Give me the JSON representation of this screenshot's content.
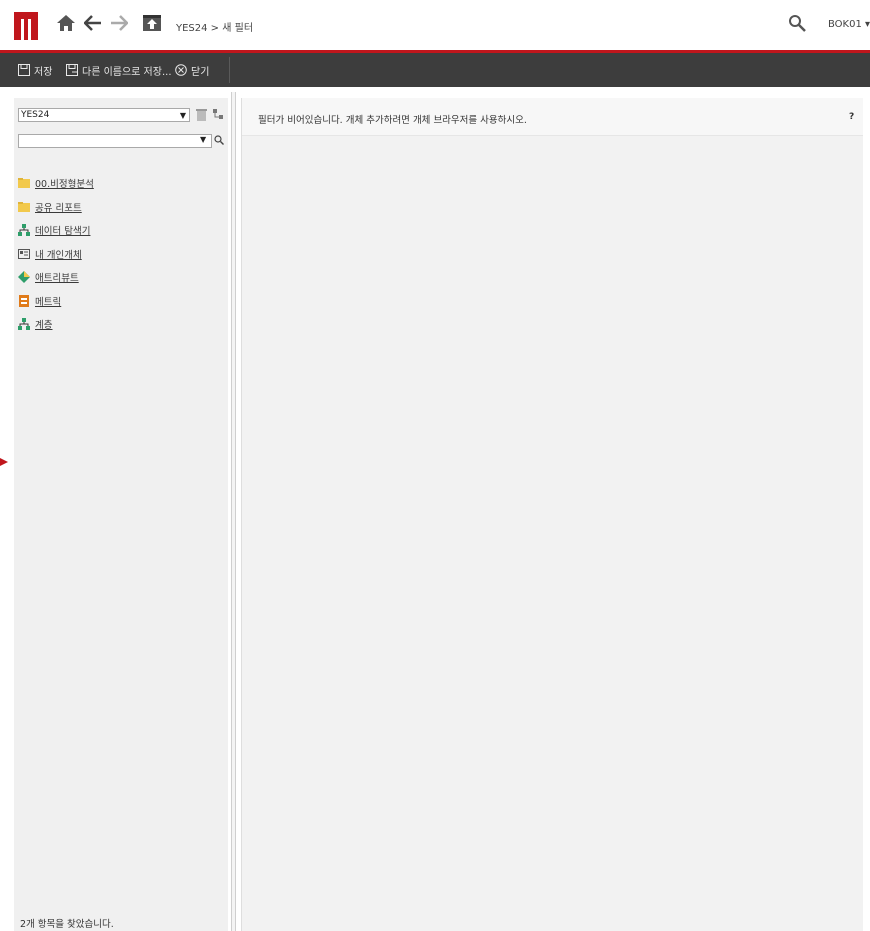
{
  "header": {
    "breadcrumb": "YES24 > 새 필터",
    "user": "BOK01 ▾",
    "accent_color": "#c0161c",
    "icons": [
      "microstrategy-logo",
      "home-icon",
      "back-arrow-icon",
      "forward-arrow-icon",
      "up-folder-icon",
      "search-icon"
    ]
  },
  "toolbar": {
    "save_label": "저장",
    "save_as_label": "다른 이름으로 저장...",
    "close_label": "닫기"
  },
  "left_panel": {
    "project_select": "YES24",
    "search_value": "",
    "tree": [
      {
        "label": "00.비정형분석",
        "icon": "folder-icon",
        "color": "#f2c94c"
      },
      {
        "label": "공유 리포트",
        "icon": "folder-icon",
        "color": "#f2c94c"
      },
      {
        "label": "데이터 탐색기",
        "icon": "hierarchy-icon",
        "color": "#2e9e6a"
      },
      {
        "label": "내 개인개체",
        "icon": "personal-objects-icon",
        "color": "#555555"
      },
      {
        "label": "애트리뷰트",
        "icon": "attribute-icon",
        "color": "#2e9e6a"
      },
      {
        "label": "메트릭",
        "icon": "metric-icon",
        "color": "#e07b1a"
      },
      {
        "label": "계층",
        "icon": "hierarchy-icon",
        "color": "#2e9e6a"
      }
    ],
    "status": "2개 항목을 찾았습니다."
  },
  "main": {
    "empty_message": "필터가 비어있습니다. 개체 추가하려면 개체 브라우저를 사용하시오.",
    "help_label": "?"
  }
}
